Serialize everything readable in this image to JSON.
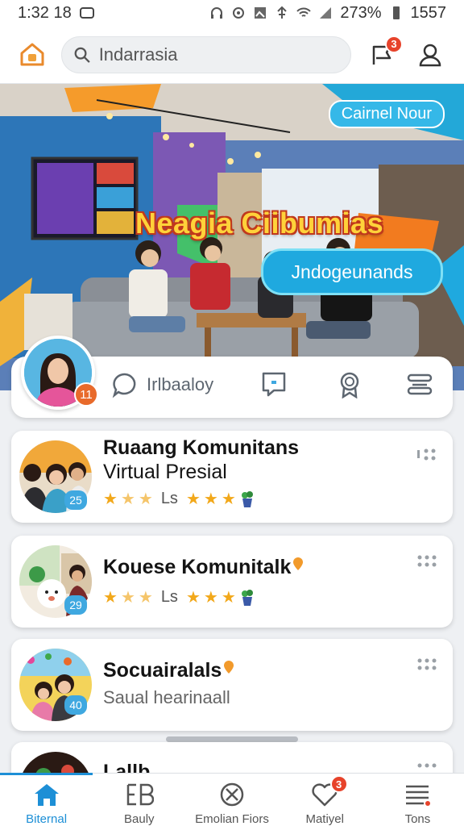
{
  "status_bar": {
    "time": "1:32 18",
    "battery": "273%",
    "signal_text": "1557"
  },
  "search": {
    "placeholder": "Indarrasia"
  },
  "header": {
    "notification_count": "3"
  },
  "banner": {
    "chip": "Cairnel Nour",
    "title": "Neagia Ciibumias",
    "bubble": "Jndogeunands"
  },
  "profile": {
    "badge": "11"
  },
  "actions": [
    {
      "label": "Irlbaaloy",
      "icon": "chat-bubble-icon"
    },
    {
      "label": "",
      "icon": "message-square-icon"
    },
    {
      "label": "",
      "icon": "award-icon"
    },
    {
      "label": "",
      "icon": "menu-lines-icon"
    }
  ],
  "communities": [
    {
      "title_line1": "Ruaang Komunitans",
      "title_line2": "Virtual Presial",
      "rating_text": "Ls",
      "count": "25"
    },
    {
      "title_line1": "Kouese Komunitalk",
      "rating_text": "Ls",
      "count": "29"
    },
    {
      "title_line1": "Socuairalals",
      "subtitle": "Saual hearinaall",
      "count": "40"
    },
    {
      "title_line1": "Lallb"
    }
  ],
  "bottom_nav": [
    {
      "label": "Biternal",
      "icon": "home-icon",
      "active": true
    },
    {
      "label": "Bauly",
      "icon": "grid-letters-icon"
    },
    {
      "label": "Emolian Fiors",
      "icon": "circle-x-icon"
    },
    {
      "label": "Matiyel",
      "icon": "heart-icon",
      "badge": "3"
    },
    {
      "label": "Tons",
      "icon": "list-icon"
    }
  ],
  "colors": {
    "accent": "#1d8fd6",
    "badge": "#e7432b",
    "star": "#f2a81a",
    "bubble": "#1fa9df"
  }
}
